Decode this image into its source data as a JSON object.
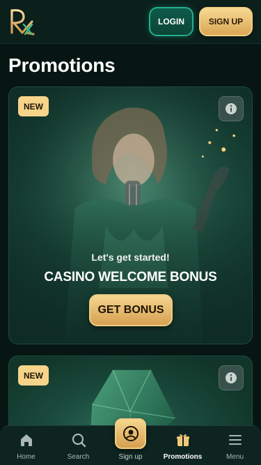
{
  "header": {
    "logo_text": "RX",
    "login_label": "LOGIN",
    "signup_label": "SIGN UP"
  },
  "page": {
    "title": "Promotions"
  },
  "promotions": [
    {
      "badge": "NEW",
      "subtitle": "Let's get started!",
      "title": "CASINO WELCOME BONUS",
      "cta_label": "GET BONUS",
      "info_icon": "info-icon"
    },
    {
      "badge": "NEW",
      "info_icon": "info-icon"
    }
  ],
  "bottom_nav": {
    "items": [
      {
        "label": "Home",
        "icon": "home-icon",
        "active": false
      },
      {
        "label": "Search",
        "icon": "search-icon",
        "active": false
      },
      {
        "label": "Sign up",
        "icon": "user-circle-icon",
        "active": false
      },
      {
        "label": "Promotions",
        "icon": "gift-icon",
        "active": true
      },
      {
        "label": "Menu",
        "icon": "hamburger-icon",
        "active": false
      }
    ]
  },
  "colors": {
    "background": "#071613",
    "accent_gold": "#f6d48a",
    "accent_teal": "#21b08f",
    "card_green": "#1d4d3f"
  }
}
